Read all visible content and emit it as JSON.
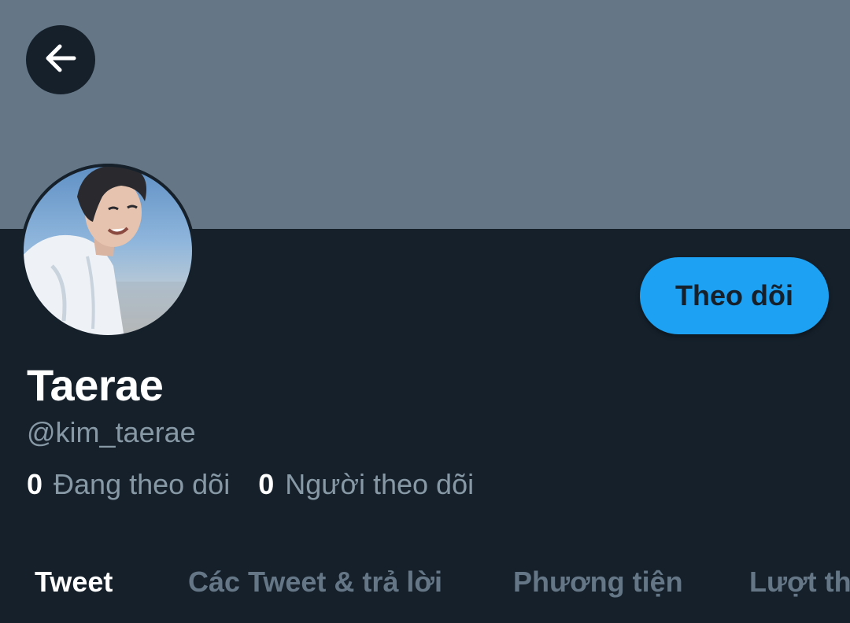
{
  "header": {
    "back_icon": "arrow-left-icon",
    "banner_color": "#657786"
  },
  "profile": {
    "avatar_icon": "avatar-photo",
    "display_name": "Taerae",
    "handle": "@kim_taerae",
    "follow_label": "Theo dõi",
    "following_count": "0",
    "following_label": "Đang theo dõi",
    "followers_count": "0",
    "followers_label": "Người theo dõi"
  },
  "tabs": [
    {
      "label": "Tweet",
      "active": true
    },
    {
      "label": "Các Tweet & trả lời",
      "active": false
    },
    {
      "label": "Phương tiện",
      "active": false
    },
    {
      "label": "Lượt thích",
      "active": false
    }
  ],
  "colors": {
    "background": "#15202b",
    "accent": "#1da1f2",
    "secondary_text": "#8899a6",
    "inactive_tab": "#657786"
  }
}
